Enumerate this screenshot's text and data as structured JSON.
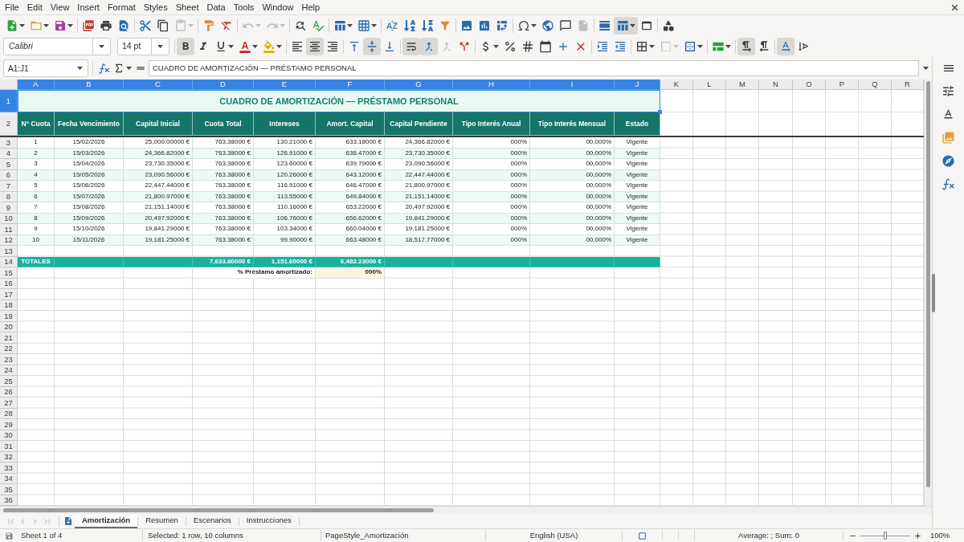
{
  "menu_bar": [
    "File",
    "Edit",
    "View",
    "Insert",
    "Format",
    "Styles",
    "Sheet",
    "Data",
    "Tools",
    "Window",
    "Help"
  ],
  "standard_toolbar": [
    {
      "pressed": false,
      "disabled": false
    },
    {
      "pressed": false,
      "disabled": false
    },
    {
      "pressed": false,
      "disabled": false
    },
    {
      "pressed": false,
      "disabled": false
    },
    {
      "pressed": false,
      "disabled": false
    },
    {
      "pressed": false,
      "disabled": false
    },
    {
      "pressed": false,
      "disabled": false
    },
    {
      "pressed": false,
      "disabled": false
    },
    {
      "pressed": false,
      "disabled": true
    },
    {
      "pressed": false,
      "disabled": false
    },
    {
      "pressed": false,
      "disabled": false
    },
    {
      "pressed": false,
      "disabled": true
    },
    {
      "pressed": false,
      "disabled": true
    },
    {
      "pressed": false,
      "disabled": false
    },
    {
      "pressed": false,
      "disabled": false
    },
    {
      "pressed": false,
      "disabled": false
    },
    {
      "pressed": false,
      "disabled": false
    },
    {
      "pressed": false,
      "disabled": false
    },
    {
      "pressed": false,
      "disabled": false
    },
    {
      "pressed": false,
      "disabled": false
    },
    {
      "pressed": false,
      "disabled": false
    },
    {
      "pressed": false,
      "disabled": false
    },
    {
      "pressed": false,
      "disabled": false
    },
    {
      "pressed": false,
      "disabled": false
    },
    {
      "pressed": false,
      "disabled": false
    },
    {
      "pressed": false,
      "disabled": false
    },
    {
      "pressed": false,
      "disabled": false
    },
    {
      "pressed": false,
      "disabled": true
    },
    {
      "pressed": false,
      "disabled": false
    },
    {
      "pressed": true,
      "disabled": false
    },
    {
      "pressed": false,
      "disabled": false
    },
    {
      "pressed": false,
      "disabled": false
    }
  ],
  "formatting_toolbar": {
    "font_name": "Calibri",
    "font_size": "14 pt",
    "buttons": [
      {
        "pressed": true,
        "disabled": false
      },
      {
        "pressed": false,
        "disabled": false
      },
      {
        "pressed": false,
        "disabled": false
      },
      {
        "pressed": false,
        "disabled": false
      },
      {
        "pressed": false,
        "disabled": false
      },
      {
        "pressed": false,
        "disabled": false
      },
      {
        "pressed": true,
        "disabled": false
      },
      {
        "pressed": false,
        "disabled": false
      },
      {
        "pressed": false,
        "disabled": false
      },
      {
        "pressed": true,
        "disabled": false
      },
      {
        "pressed": false,
        "disabled": false
      },
      {
        "pressed": true,
        "disabled": false
      },
      {
        "pressed": true,
        "disabled": false
      },
      {
        "pressed": false,
        "disabled": true
      },
      {
        "pressed": false,
        "disabled": false
      },
      {
        "pressed": false,
        "disabled": false
      },
      {
        "pressed": false,
        "disabled": false
      },
      {
        "pressed": false,
        "disabled": false
      },
      {
        "pressed": false,
        "disabled": false
      },
      {
        "pressed": false,
        "disabled": false
      },
      {
        "pressed": false,
        "disabled": false
      },
      {
        "pressed": false,
        "disabled": false
      },
      {
        "pressed": false,
        "disabled": false
      },
      {
        "pressed": false,
        "disabled": false
      },
      {
        "pressed": false,
        "disabled": true
      },
      {
        "pressed": false,
        "disabled": false
      },
      {
        "pressed": false,
        "disabled": false
      },
      {
        "pressed": true,
        "disabled": false
      },
      {
        "pressed": false,
        "disabled": false
      },
      {
        "pressed": true,
        "disabled": false
      },
      {
        "pressed": false,
        "disabled": false
      }
    ]
  },
  "formula_bar": {
    "name_box": "A1:J1",
    "contents": "CUADRO DE AMORTIZACIÓN — PRÉSTAMO PERSONAL"
  },
  "sheet": {
    "columns": [
      {
        "label": "A",
        "selected": true
      },
      {
        "label": "B",
        "selected": true
      },
      {
        "label": "C",
        "selected": true
      },
      {
        "label": "D",
        "selected": true
      },
      {
        "label": "E",
        "selected": true
      },
      {
        "label": "F",
        "selected": true
      },
      {
        "label": "G",
        "selected": true
      },
      {
        "label": "H",
        "selected": true
      },
      {
        "label": "I",
        "selected": true
      },
      {
        "label": "J",
        "selected": true
      },
      {
        "label": "K",
        "selected": false
      },
      {
        "label": "L",
        "selected": false
      },
      {
        "label": "M",
        "selected": false
      },
      {
        "label": "N",
        "selected": false
      },
      {
        "label": "O",
        "selected": false
      },
      {
        "label": "P",
        "selected": false
      },
      {
        "label": "Q",
        "selected": false
      },
      {
        "label": "R",
        "selected": false
      }
    ],
    "rows": [
      {
        "label": "1",
        "selected": true
      },
      {
        "label": "2",
        "selected": false
      },
      {
        "label": "3",
        "selected": false
      },
      {
        "label": "4",
        "selected": false
      },
      {
        "label": "5",
        "selected": false
      },
      {
        "label": "6",
        "selected": false
      },
      {
        "label": "7",
        "selected": false
      },
      {
        "label": "8",
        "selected": false
      },
      {
        "label": "9",
        "selected": false
      },
      {
        "label": "10",
        "selected": false
      },
      {
        "label": "11",
        "selected": false
      },
      {
        "label": "12",
        "selected": false
      },
      {
        "label": "13",
        "selected": false
      },
      {
        "label": "14",
        "selected": false
      },
      {
        "label": "15",
        "selected": false
      },
      {
        "label": "16",
        "selected": false
      },
      {
        "label": "17",
        "selected": false
      },
      {
        "label": "18",
        "selected": false
      },
      {
        "label": "19",
        "selected": false
      },
      {
        "label": "20",
        "selected": false
      },
      {
        "label": "21",
        "selected": false
      },
      {
        "label": "22",
        "selected": false
      },
      {
        "label": "23",
        "selected": false
      },
      {
        "label": "24",
        "selected": false
      },
      {
        "label": "25",
        "selected": false
      },
      {
        "label": "26",
        "selected": false
      },
      {
        "label": "27",
        "selected": false
      },
      {
        "label": "28",
        "selected": false
      },
      {
        "label": "29",
        "selected": false
      },
      {
        "label": "30",
        "selected": false
      },
      {
        "label": "31",
        "selected": false
      },
      {
        "label": "32",
        "selected": false
      },
      {
        "label": "33",
        "selected": false
      },
      {
        "label": "34",
        "selected": false
      },
      {
        "label": "35",
        "selected": false
      },
      {
        "label": "36",
        "selected": false
      }
    ],
    "title": {
      "text": "CUADRO DE AMORTIZACIÓN — PRÉSTAMO PERSONAL",
      "selected": true
    },
    "header": [
      "N° Cuota",
      "Fecha Vencimiento",
      "Capital Inicial",
      "Cuota Total",
      "Intereses",
      "Amort. Capital",
      "Capital Pendiente",
      "Tipo Interés Anual",
      "Tipo Interés Mensual",
      "Estado"
    ],
    "schedule": [
      [
        "1",
        "15/02/2026",
        "25,000.00000 €",
        "763.38000 €",
        "130.21000 €",
        "633.18000 €",
        "24,366.82000 €",
        "000%",
        "00,000%",
        "Vigente"
      ],
      [
        "2",
        "15/03/2026",
        "24,366.82000 €",
        "763.38000 €",
        "126.91000 €",
        "636.47000 €",
        "23,730.35000 €",
        "000%",
        "00,000%",
        "Vigente"
      ],
      [
        "3",
        "15/04/2026",
        "23,730.35000 €",
        "763.38000 €",
        "123.60000 €",
        "639.79000 €",
        "23,090.56000 €",
        "000%",
        "00,000%",
        "Vigente"
      ],
      [
        "4",
        "15/05/2026",
        "23,090.56000 €",
        "763.38000 €",
        "120.26000 €",
        "643.12000 €",
        "22,447.44000 €",
        "000%",
        "00,000%",
        "Vigente"
      ],
      [
        "5",
        "15/06/2026",
        "22,447.44000 €",
        "763.38000 €",
        "116.91000 €",
        "646.47000 €",
        "21,800.97000 €",
        "000%",
        "00,000%",
        "Vigente"
      ],
      [
        "6",
        "15/07/2026",
        "21,800.97000 €",
        "763.38000 €",
        "113.55000 €",
        "649.84000 €",
        "21,151.14000 €",
        "000%",
        "00,000%",
        "Vigente"
      ],
      [
        "7",
        "15/08/2026",
        "21,151.14000 €",
        "763.38000 €",
        "110.16000 €",
        "653.22000 €",
        "20,497.92000 €",
        "000%",
        "00,000%",
        "Vigente"
      ],
      [
        "8",
        "15/09/2026",
        "20,497.92000 €",
        "763.38000 €",
        "106.76000 €",
        "656.62000 €",
        "19,841.29000 €",
        "000%",
        "00,000%",
        "Vigente"
      ],
      [
        "9",
        "15/10/2026",
        "19,841.29000 €",
        "763.38000 €",
        "103.34000 €",
        "660.04000 €",
        "19,181.25000 €",
        "000%",
        "00,000%",
        "Vigente"
      ],
      [
        "10",
        "15/11/2026",
        "19,181.25000 €",
        "763.38000 €",
        "99.90000 €",
        "663.48000 €",
        "18,517.77000 €",
        "000%",
        "00,000%",
        "Vigente"
      ]
    ],
    "totals": {
      "label": "TOTALES",
      "cuota_total": "7,633.80000 €",
      "intereses": "1,151.60000 €",
      "amort_capital": "6,482.23000 €"
    },
    "summary": {
      "label": "% Préstamo amortizado:",
      "value": "000%"
    }
  },
  "sheet_navigation": [
    {
      "disabled": true
    },
    {
      "disabled": true
    },
    {
      "disabled": true
    },
    {
      "disabled": true
    }
  ],
  "sheet_tabs": [
    {
      "label": "Amortización",
      "selected": true
    },
    {
      "label": "Resumen",
      "selected": false
    },
    {
      "label": "Escenarios",
      "selected": false
    },
    {
      "label": "Instrucciones",
      "selected": false
    }
  ],
  "status_bar": {
    "sheet_position": "Sheet 1 of 4",
    "selection": "Selected: 1 row, 10 columns",
    "page_style": "PageStyle_Amortización",
    "language": "English (USA)",
    "statistics": "Average: ; Sum: 0",
    "zoom": {
      "level": 0.5,
      "percent": "100%"
    }
  }
}
